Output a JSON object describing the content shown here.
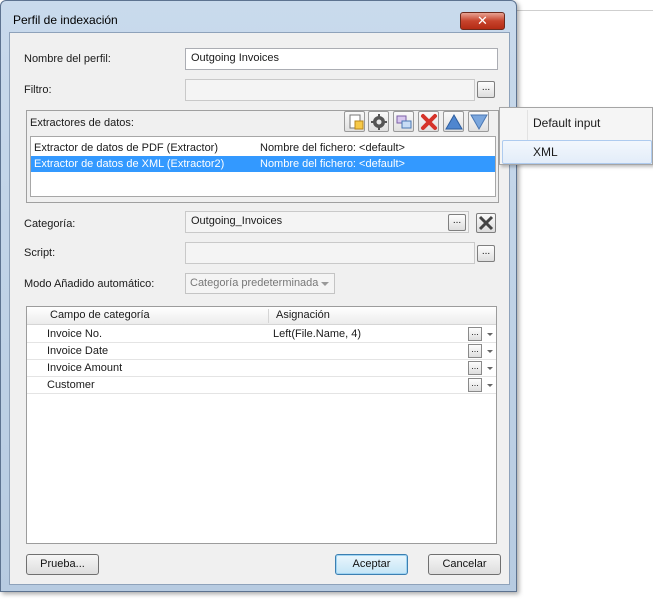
{
  "dialog": {
    "title": "Perfil de indexación",
    "close_label": "✕"
  },
  "fields": {
    "profile_name_label": "Nombre del perfil:",
    "profile_name_value": "Outgoing Invoices",
    "filter_label": "Filtro:",
    "filter_value": "",
    "category_label": "Categoría:",
    "category_value": "Outgoing_Invoices",
    "script_label": "Script:",
    "script_value": "",
    "auto_mode_label": "Modo Añadido automático:",
    "auto_mode_value": "Categoría predeterminada",
    "browse_label": "..."
  },
  "extractors": {
    "label": "Extractores de datos:",
    "toolbar_icons": [
      "new-document-icon",
      "gear-icon",
      "copy-icon",
      "delete-icon",
      "move-up-icon",
      "move-down-icon"
    ],
    "rows": [
      {
        "name": "Extractor de datos de PDF (Extractor)",
        "file": "Nombre del fichero: <default>",
        "selected": false
      },
      {
        "name": "Extractor de datos de XML (Extractor2)",
        "file": "Nombre del fichero: <default>",
        "selected": true
      }
    ]
  },
  "grid": {
    "col1": "Campo de categoría",
    "col2": "Asignación",
    "rows": [
      {
        "field": "Invoice No.",
        "value": "Left(File.Name, 4)"
      },
      {
        "field": "Invoice Date",
        "value": ""
      },
      {
        "field": "Invoice Amount",
        "value": ""
      },
      {
        "field": "Customer",
        "value": ""
      }
    ]
  },
  "buttons": {
    "test": "Prueba...",
    "accept": "Aceptar",
    "cancel": "Cancelar"
  },
  "popup_menu": {
    "items": [
      "Default input",
      "XML"
    ],
    "highlighted": "XML"
  },
  "colors": {
    "selection": "#3399ff",
    "title_gradient": "#c9daec",
    "close_red": "#c7432c"
  }
}
